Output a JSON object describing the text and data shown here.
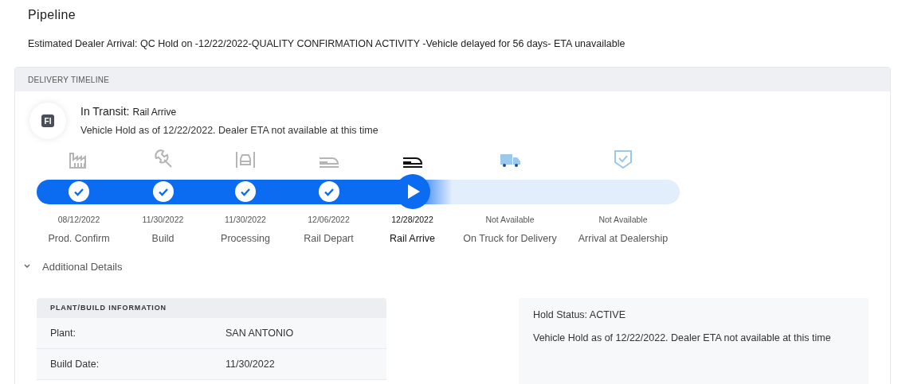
{
  "page_title": "Pipeline",
  "estimate": "Estimated Dealer Arrival: QC Hold on -12/22/2022-QUALITY CONFIRMATION ACTIVITY -Vehicle delayed for 56 days- ETA unavailable",
  "timeline": {
    "header": "DELIVERY TIMELINE",
    "badge": "FI",
    "status_label": "In Transit:",
    "status_value": "Rail Arrive",
    "status_note": "Vehicle Hold as of 12/22/2022. Dealer ETA not available at this time",
    "steps": [
      {
        "kind": "factory",
        "completed": true,
        "selected": false,
        "date": "08/12/2022",
        "label": "Prod. Confirm"
      },
      {
        "kind": "wrench",
        "completed": true,
        "selected": false,
        "date": "11/30/2022",
        "label": "Build"
      },
      {
        "kind": "lift",
        "completed": true,
        "selected": false,
        "date": "11/30/2022",
        "label": "Processing"
      },
      {
        "kind": "rail",
        "completed": true,
        "selected": false,
        "date": "12/06/2022",
        "label": "Rail Depart"
      },
      {
        "kind": "rail",
        "completed": false,
        "selected": true,
        "date": "12/28/2022",
        "label": "Rail Arrive"
      },
      {
        "kind": "truck",
        "completed": false,
        "selected": false,
        "date": "Not Available",
        "label": "On Truck for Delivery"
      },
      {
        "kind": "shield",
        "completed": false,
        "selected": false,
        "date": "Not Available",
        "label": "Arrival at Dealership"
      }
    ]
  },
  "details": {
    "toggle": "Additional Details",
    "expanded": true,
    "plant_table": {
      "header": "PLANT/BUILD INFORMATION",
      "rows": [
        {
          "label": "Plant:",
          "value": "SAN ANTONIO"
        },
        {
          "label": "Build Date:",
          "value": "11/30/2022"
        }
      ]
    },
    "hold": {
      "status": "Hold Status: ACTIVE",
      "note": "Vehicle Hold as of 12/22/2022. Dealer ETA not available at this time"
    }
  }
}
